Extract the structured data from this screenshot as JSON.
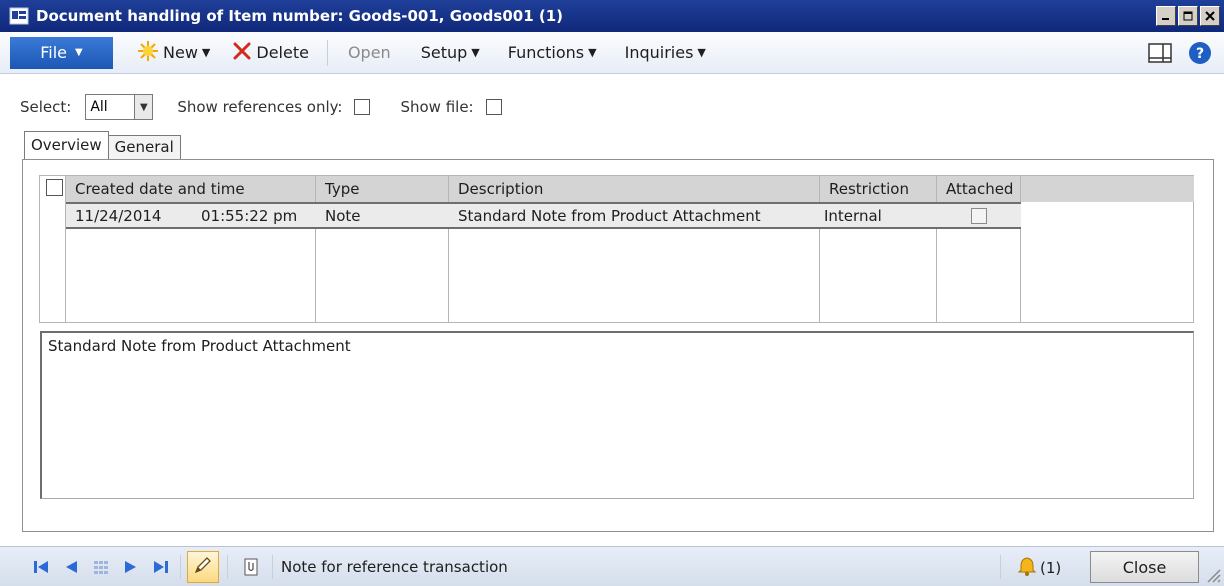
{
  "window": {
    "title": "Document handling of Item number: Goods-001, Goods001 (1)"
  },
  "actions": {
    "file": "File",
    "new": "New",
    "delete": "Delete",
    "open": "Open",
    "setup": "Setup",
    "functions": "Functions",
    "inquiries": "Inquiries"
  },
  "filter": {
    "select_label": "Select:",
    "select_value": "All",
    "show_refs_label": "Show references only:",
    "show_file_label": "Show file:"
  },
  "tabs": [
    "Overview",
    "General"
  ],
  "grid": {
    "columns": [
      "Created date and time",
      "Type",
      "Description",
      "Restriction",
      "Attached"
    ],
    "rows": [
      {
        "date": "11/24/2014",
        "time": "01:55:22 pm",
        "type": "Note",
        "description": "Standard Note from Product Attachment",
        "restriction": "Internal"
      }
    ]
  },
  "note_text": "Standard Note from Product Attachment",
  "status": {
    "text": "Note for reference transaction",
    "alert_count": "(1)",
    "close": "Close"
  }
}
